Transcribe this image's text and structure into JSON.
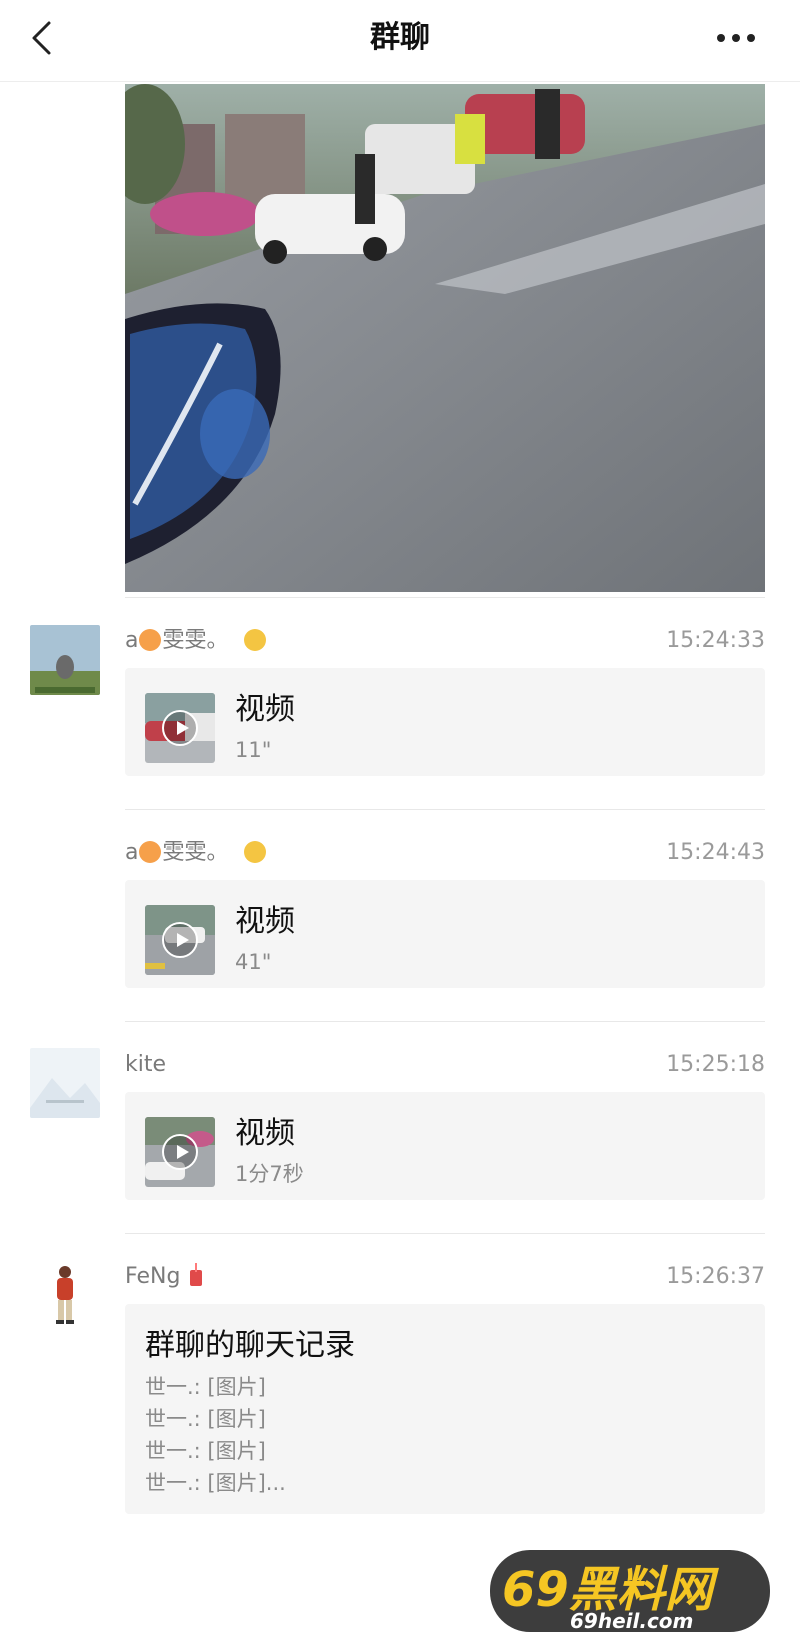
{
  "header": {
    "title": "群聊",
    "back_icon": "chevron-left-icon",
    "more_icon": "ellipsis-icon"
  },
  "messages": [
    {
      "sender": "a",
      "sender_suffix": "雯雯。",
      "time": "15:24:33",
      "type": "video",
      "video_label": "视频",
      "duration": "11\""
    },
    {
      "sender": "a",
      "sender_suffix": "雯雯。",
      "time": "15:24:43",
      "type": "video",
      "video_label": "视频",
      "duration": "41\""
    },
    {
      "sender": "kite",
      "time": "15:25:18",
      "type": "video",
      "video_label": "视频",
      "duration": "1分7秒"
    },
    {
      "sender": "FeNg",
      "time": "15:26:37",
      "type": "chat-record",
      "record_title": "群聊的聊天记录",
      "record_lines": [
        "世一.: [图片]",
        "世一.: [图片]",
        "世一.: [图片]",
        "世一.: [图片]..."
      ]
    }
  ],
  "watermark": {
    "line1": "69黑料网",
    "line2": "69heil.com"
  },
  "colors": {
    "card_bg": "#f5f5f5",
    "meta_text": "#9a9a9a",
    "separator": "#e8e8e8"
  }
}
